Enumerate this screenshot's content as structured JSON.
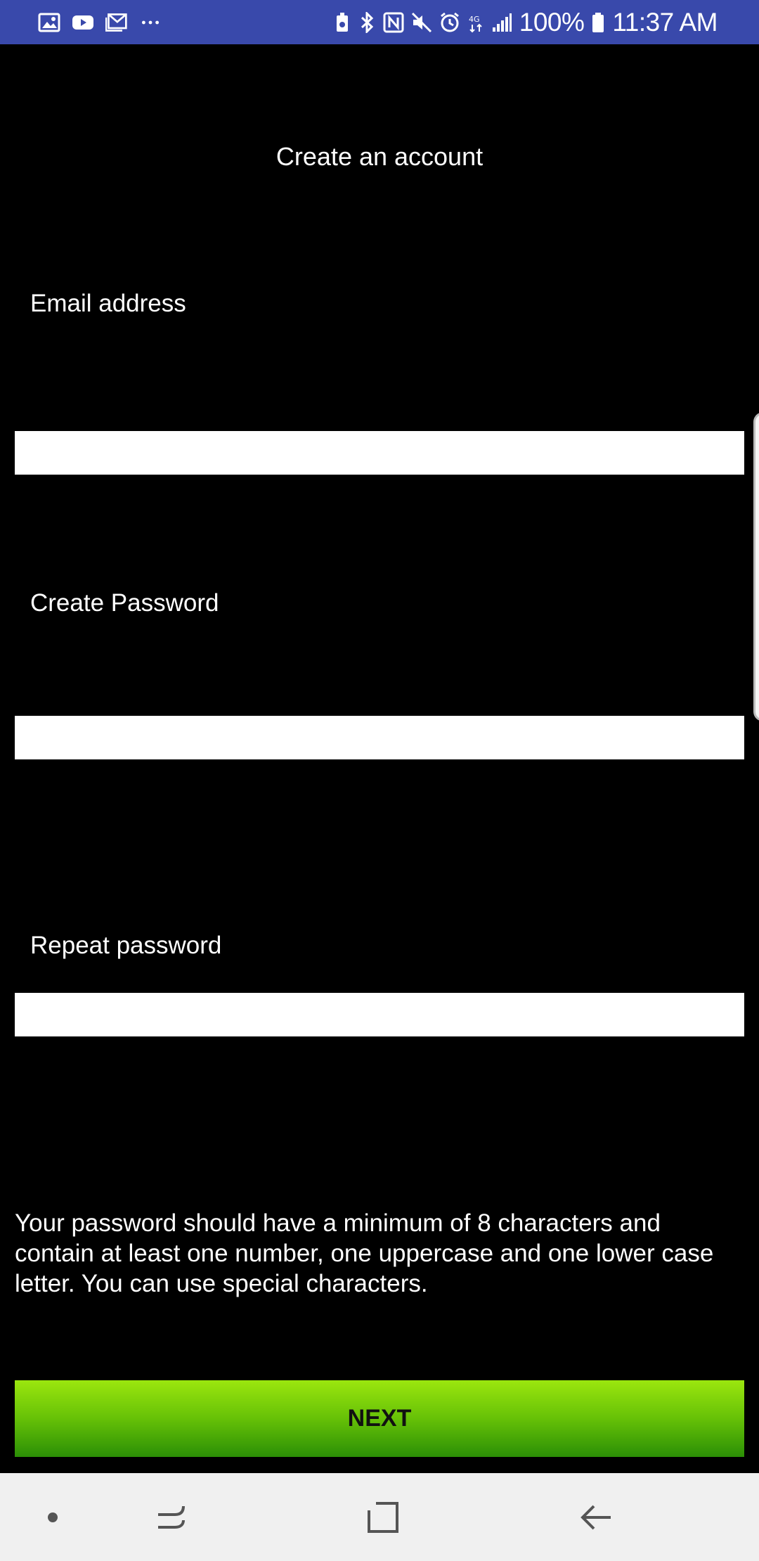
{
  "status_bar": {
    "battery_percent": "100%",
    "time": "11:37 AM",
    "left_icons": [
      "gallery-icon",
      "youtube-icon",
      "mail-icon",
      "more-dots-icon"
    ],
    "right_icons": [
      "battery-saver-icon",
      "bluetooth-icon",
      "nfc-icon",
      "mute-icon",
      "alarm-icon",
      "data-4g-icon",
      "signal-icon",
      "battery-icon"
    ],
    "background_color": "#3949ab"
  },
  "form": {
    "title": "Create an account",
    "email_label": "Email address",
    "email_value": "",
    "password_label": "Create Password",
    "password_value": "",
    "repeat_label": "Repeat password",
    "repeat_value": "",
    "hint": "Your password should have a minimum of 8 characters and contain at least one number, one uppercase and one lower case letter. You can use special characters.",
    "next_label": "NEXT",
    "next_color": "#66c107"
  },
  "nav_bar": {
    "items": [
      "dot-icon",
      "recents-icon",
      "home-icon",
      "back-icon"
    ],
    "background_color": "#f0f0f0"
  }
}
